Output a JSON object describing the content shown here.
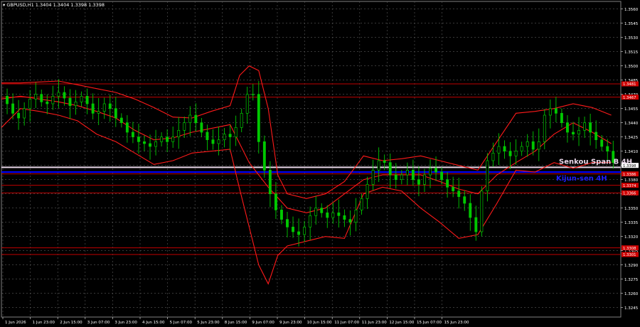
{
  "header": {
    "symbol_line": "▾ GBPUSD,H1  1.3404 1.3404 1.3398 1.3398"
  },
  "colors": {
    "background": "#000000",
    "grid": "#5a5a5a",
    "bull_candle": "#00c800",
    "bear_candle": "#00c800",
    "bands": "#ff1a1a",
    "level_red": "#c00000",
    "senkou": "#e8d6e8",
    "kijun": "#0000ff",
    "axis_text": "#ffffff",
    "price_tag_bg": "#ffffff",
    "red_tag_bg": "#d00000"
  },
  "annotations": {
    "senkou_label": "Senkou Span B 4H",
    "kijun_label": "Kijun-sen 4H",
    "current_price": "1.3398"
  },
  "chart_data": {
    "type": "line",
    "title": "GBPUSD,H1",
    "xlabel": "",
    "ylabel": "",
    "ylim": [
      1.3235,
      1.3568
    ],
    "grid": true,
    "legend": "none",
    "y_ticks": [
      "1.3560",
      "1.3545",
      "1.3530",
      "1.3515",
      "1.3500",
      "1.3485",
      "1.3470",
      "1.3455",
      "1.3440",
      "1.3425",
      "1.3410",
      "1.3395",
      "1.3380",
      "1.3365",
      "1.3350",
      "1.3335",
      "1.3320",
      "1.3305",
      "1.3290",
      "1.3275",
      "1.3260",
      "1.3245"
    ],
    "x_ticks": [
      "1 Jun 2026",
      "1 Jun 23:00",
      "2 Jun 15:00",
      "3 Jun 07:00",
      "3 Jun 23:00",
      "4 Jun 15:00",
      "5 Jun 07:00",
      "5 Jun 23:00",
      "8 Jun 15:00",
      "9 Jun 07:00",
      "9 Jun 23:00",
      "10 Jun 15:00",
      "11 Jun 07:00",
      "11 Jun 23:00",
      "12 Jun 15:00",
      "15 Jun 07:00",
      "15 Jun 23:00"
    ],
    "horizontal_levels": [
      {
        "price": 1.3481,
        "label": "1.3481"
      },
      {
        "price": 1.3467,
        "label": "1.3467"
      },
      {
        "price": 1.3386,
        "label": "1.3386"
      },
      {
        "price": 1.3374,
        "label": "1.3374"
      },
      {
        "price": 1.3366,
        "label": "1.3366"
      },
      {
        "price": 1.3308,
        "label": "1.3308"
      },
      {
        "price": 1.3301,
        "label": "1.3301"
      }
    ],
    "senkou_span_b_4h": 1.3393,
    "kijun_sen_4h": 1.3388,
    "series": [
      {
        "name": "Close",
        "x": [
          0,
          6,
          12,
          18,
          24,
          30,
          36,
          42,
          48,
          54,
          60,
          66,
          72,
          78,
          84,
          90,
          96,
          102,
          108,
          114,
          120,
          126,
          132,
          138,
          144,
          150,
          156,
          162,
          168,
          174,
          180,
          186,
          192,
          198,
          204,
          210,
          216,
          222,
          228,
          234,
          240,
          246,
          252,
          258,
          264,
          270,
          276,
          282,
          288,
          294,
          300,
          306,
          312,
          318,
          324,
          330,
          336,
          342,
          348,
          354,
          360,
          366,
          372,
          378,
          384,
          390,
          396,
          402,
          408,
          414,
          420,
          426,
          432,
          438,
          444,
          450,
          456,
          462,
          468,
          474,
          480,
          486,
          492,
          498,
          504,
          510,
          516,
          522,
          528,
          534,
          540,
          546,
          552,
          558,
          564,
          570,
          576,
          582,
          588,
          594,
          600,
          606,
          612,
          618,
          624,
          630,
          636,
          642
        ],
        "values": [
          1.3468,
          1.346,
          1.345,
          1.3445,
          1.3455,
          1.3465,
          1.347,
          1.3462,
          1.346,
          1.3468,
          1.3472,
          1.3466,
          1.3458,
          1.3462,
          1.3468,
          1.346,
          1.345,
          1.3452,
          1.346,
          1.3455,
          1.3445,
          1.344,
          1.343,
          1.3425,
          1.342,
          1.3418,
          1.3415,
          1.342,
          1.3425,
          1.342,
          1.3425,
          1.3432,
          1.344,
          1.3448,
          1.344,
          1.343,
          1.3422,
          1.3418,
          1.3422,
          1.3428,
          1.3425,
          1.3435,
          1.345,
          1.347,
          1.347,
          1.342,
          1.339,
          1.3365,
          1.3348,
          1.3338,
          1.333,
          1.3325,
          1.3322,
          1.333,
          1.3342,
          1.335,
          1.3345,
          1.334,
          1.3345,
          1.3342,
          1.3338,
          1.3335,
          1.3348,
          1.336,
          1.3375,
          1.339,
          1.34,
          1.3398,
          1.3385,
          1.338,
          1.3385,
          1.339,
          1.338,
          1.3375,
          1.3385,
          1.3392,
          1.3388,
          1.338,
          1.3372,
          1.3368,
          1.3362,
          1.3355,
          1.334,
          1.3325,
          1.3368,
          1.34,
          1.3408,
          1.3415,
          1.341,
          1.3405,
          1.341,
          1.3415,
          1.342,
          1.3412,
          1.342,
          1.3448,
          1.3455,
          1.345,
          1.344,
          1.343,
          1.3428,
          1.3432,
          1.344,
          1.343,
          1.3422,
          1.3415,
          1.341,
          1.3398
        ]
      },
      {
        "name": "Upper band",
        "x": [
          0,
          20,
          40,
          60,
          80,
          100,
          120,
          140,
          160,
          180,
          200,
          220,
          240,
          250,
          260,
          270,
          280,
          290,
          300,
          320,
          340,
          360,
          380,
          400,
          420,
          440,
          460,
          480,
          500,
          520,
          540,
          560,
          580,
          600,
          620,
          640
        ],
        "values": [
          1.3482,
          1.3482,
          1.3483,
          1.3484,
          1.348,
          1.3476,
          1.3472,
          1.3465,
          1.3456,
          1.3446,
          1.3445,
          1.3452,
          1.3458,
          1.349,
          1.35,
          1.3495,
          1.3455,
          1.3385,
          1.3365,
          1.336,
          1.3365,
          1.3378,
          1.3405,
          1.34,
          1.3402,
          1.3405,
          1.34,
          1.3395,
          1.339,
          1.342,
          1.345,
          1.3452,
          1.3455,
          1.346,
          1.3456,
          1.3448
        ]
      },
      {
        "name": "Middle band",
        "x": [
          0,
          20,
          40,
          60,
          80,
          100,
          120,
          140,
          160,
          180,
          200,
          220,
          240,
          260,
          280,
          300,
          320,
          340,
          360,
          380,
          400,
          420,
          440,
          460,
          480,
          500,
          520,
          540,
          560,
          580,
          600,
          620,
          640
        ],
        "values": [
          1.3465,
          1.3468,
          1.3465,
          1.3462,
          1.3458,
          1.3452,
          1.3445,
          1.3432,
          1.3422,
          1.3424,
          1.343,
          1.3434,
          1.3438,
          1.3398,
          1.3372,
          1.335,
          1.3345,
          1.335,
          1.3365,
          1.338,
          1.3385,
          1.3385,
          1.3385,
          1.3378,
          1.337,
          1.3365,
          1.3385,
          1.3398,
          1.341,
          1.3428,
          1.344,
          1.343,
          1.3418
        ]
      },
      {
        "name": "Lower band",
        "x": [
          0,
          20,
          40,
          60,
          80,
          100,
          120,
          140,
          160,
          180,
          200,
          220,
          240,
          250,
          260,
          270,
          280,
          290,
          300,
          320,
          340,
          360,
          380,
          400,
          420,
          440,
          460,
          480,
          500,
          520,
          540,
          560,
          580,
          600,
          620,
          640
        ],
        "values": [
          1.3435,
          1.3455,
          1.3452,
          1.3448,
          1.3442,
          1.3428,
          1.342,
          1.3408,
          1.3396,
          1.34,
          1.3408,
          1.341,
          1.3412,
          1.337,
          1.333,
          1.329,
          1.327,
          1.33,
          1.331,
          1.3315,
          1.332,
          1.3318,
          1.3365,
          1.3372,
          1.3368,
          1.335,
          1.3335,
          1.3318,
          1.3322,
          1.3355,
          1.339,
          1.3388,
          1.3398,
          1.3392,
          1.3398,
          1.3398
        ]
      }
    ]
  }
}
